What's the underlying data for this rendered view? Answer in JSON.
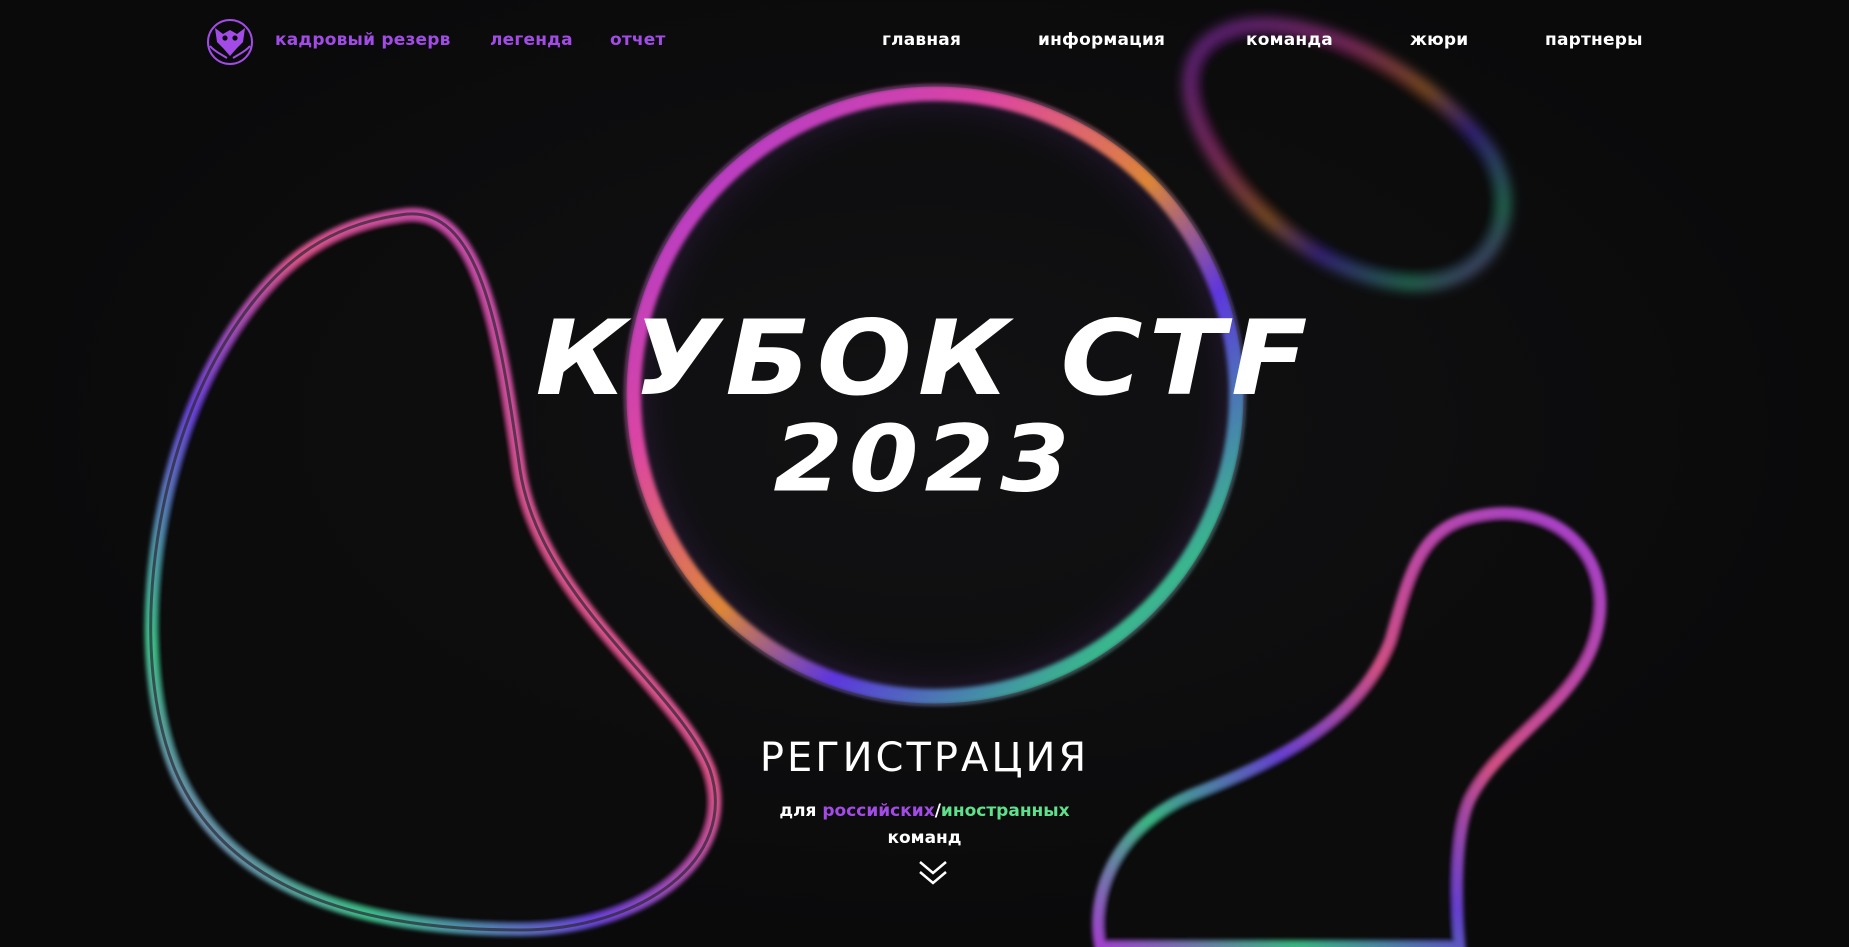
{
  "nav": {
    "logo_icon": "owl-logo-icon",
    "left_links": [
      "кадровый резерв",
      "легенда",
      "отчет"
    ],
    "right_links": [
      "главная",
      "информация",
      "команда",
      "жюри",
      "партнеры"
    ]
  },
  "hero": {
    "title_line1": "кубок ctf",
    "title_line2": "2023"
  },
  "registration": {
    "title": "регистрация",
    "prefix": "для ",
    "russian": "российских",
    "separator": "/",
    "foreign": "иностранных",
    "suffix": "команд",
    "arrow_icon": "double-chevron-down-icon"
  },
  "colors": {
    "accent_purple": "#a24be6",
    "accent_green": "#5fe08a",
    "background": "#0b0b0c",
    "text": "#ffffff"
  }
}
